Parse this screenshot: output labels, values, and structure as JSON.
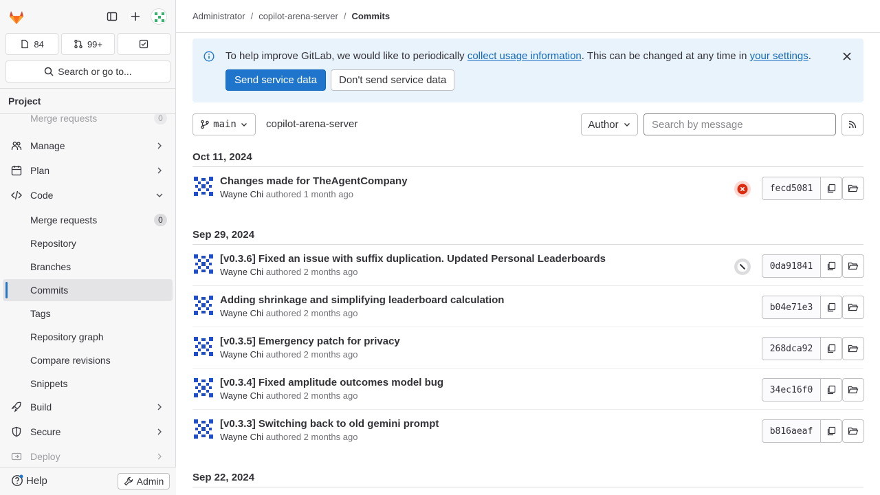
{
  "sidebar": {
    "counters": [
      {
        "icon": "issues-icon",
        "label": "84"
      },
      {
        "icon": "merge-request-icon",
        "label": "99+"
      },
      {
        "icon": "todo-icon",
        "label": ""
      }
    ],
    "search_label": "Search or go to...",
    "section_title": "Project",
    "items": [
      {
        "label": "Merge requests",
        "badge": "0",
        "faded": true
      },
      {
        "label": "Manage",
        "icon": "users-icon"
      },
      {
        "label": "Plan",
        "icon": "calendar-icon"
      },
      {
        "label": "Code",
        "icon": "code-icon",
        "expanded": true
      },
      {
        "label": "Merge requests",
        "badge": "0"
      },
      {
        "label": "Repository"
      },
      {
        "label": "Branches"
      },
      {
        "label": "Commits",
        "active": true
      },
      {
        "label": "Tags"
      },
      {
        "label": "Repository graph"
      },
      {
        "label": "Compare revisions"
      },
      {
        "label": "Snippets"
      },
      {
        "label": "Build",
        "icon": "rocket-icon"
      },
      {
        "label": "Secure",
        "icon": "shield-icon"
      },
      {
        "label": "Deploy",
        "icon": "deploy-icon"
      }
    ],
    "help_label": "Help",
    "admin_label": "Admin"
  },
  "breadcrumb": [
    "Administrator",
    "copilot-arena-server",
    "Commits"
  ],
  "alert": {
    "text_before": "To help improve GitLab, we would like to periodically ",
    "link1": "collect usage information",
    "text_middle": ". This can be changed at any time in ",
    "link2": "your settings",
    "text_after": ".",
    "primary_button": "Send service data",
    "secondary_button": "Don't send service data"
  },
  "toolbar": {
    "branch": "main",
    "project_path": "copilot-arena-server",
    "author_label": "Author",
    "search_placeholder": "Search by message"
  },
  "groups": [
    {
      "date": "Oct 11, 2024",
      "commits": [
        {
          "title": "Changes made for TheAgentCompany",
          "author": "Wayne Chi",
          "authored": "authored 1 month ago",
          "sha": "fecd5081",
          "status": "failed"
        }
      ]
    },
    {
      "date": "Sep 29, 2024",
      "commits": [
        {
          "title": "[v0.3.6] Fixed an issue with suffix duplication. Updated Personal Leaderboards",
          "author": "Wayne Chi",
          "authored": "authored 2 months ago",
          "sha": "0da91841",
          "status": "skipped"
        },
        {
          "title": "Adding shrinkage and simplifying leaderboard calculation",
          "author": "Wayne Chi",
          "authored": "authored 2 months ago",
          "sha": "b04e71e3",
          "status": ""
        },
        {
          "title": "[v0.3.5] Emergency patch for privacy",
          "author": "Wayne Chi",
          "authored": "authored 2 months ago",
          "sha": "268dca92",
          "status": ""
        },
        {
          "title": "[v0.3.4] Fixed amplitude outcomes model bug",
          "author": "Wayne Chi",
          "authored": "authored 2 months ago",
          "sha": "34ec16f0",
          "status": ""
        },
        {
          "title": "[v0.3.3] Switching back to old gemini prompt",
          "author": "Wayne Chi",
          "authored": "authored 2 months ago",
          "sha": "b816aeaf",
          "status": ""
        }
      ]
    },
    {
      "date": "Sep 22, 2024",
      "commits": []
    }
  ],
  "colors": {
    "accent": "#1f75cb",
    "failed": "#dd2b0e",
    "alert_bg": "#e9f3fc"
  }
}
